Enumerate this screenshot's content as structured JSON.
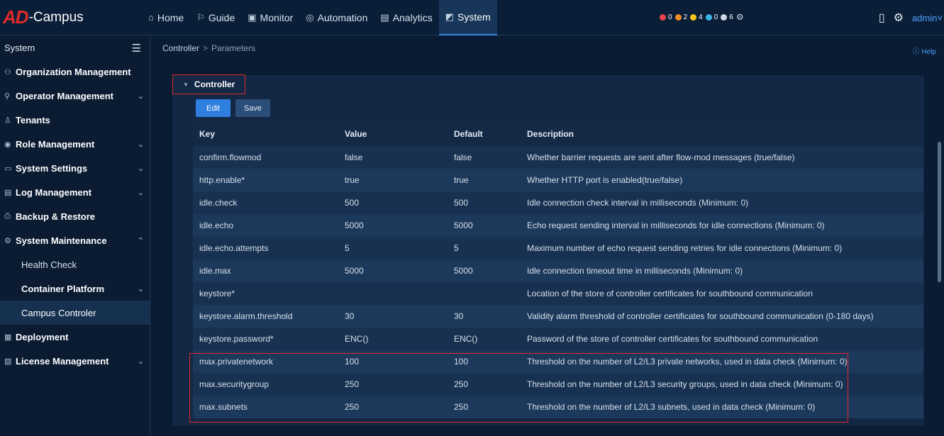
{
  "logo": {
    "mark": "AD",
    "text": "-Campus"
  },
  "nav": [
    {
      "icon": "⌂",
      "label": "Home"
    },
    {
      "icon": "⚐",
      "label": "Guide"
    },
    {
      "icon": "▣",
      "label": "Monitor"
    },
    {
      "icon": "◎",
      "label": "Automation"
    },
    {
      "icon": "▤",
      "label": "Analytics"
    },
    {
      "icon": "◩",
      "label": "System"
    }
  ],
  "alarms": [
    {
      "count": "0",
      "color": "#e8434b"
    },
    {
      "count": "2",
      "color": "#f08c2a"
    },
    {
      "count": "4",
      "color": "#f5c518"
    },
    {
      "count": "0",
      "color": "#3bb4e8"
    },
    {
      "count": "6",
      "color": "#cfd8e4"
    }
  ],
  "user": {
    "name": "admin"
  },
  "sidebar": {
    "title": "System",
    "items": [
      {
        "label": "Organization Management",
        "icon": "⚇"
      },
      {
        "label": "Operator Management",
        "icon": "⚲"
      },
      {
        "label": "Tenants",
        "icon": "♙"
      },
      {
        "label": "Role Management",
        "icon": "◉"
      },
      {
        "label": "System Settings",
        "icon": "▭"
      },
      {
        "label": "Log Management",
        "icon": "▤"
      },
      {
        "label": "Backup & Restore",
        "icon": "⎙"
      },
      {
        "label": "System Maintenance",
        "icon": "⚙"
      }
    ],
    "subitems": [
      {
        "label": "Health Check"
      },
      {
        "label": "Container Platform"
      },
      {
        "label": "Campus Controler"
      }
    ],
    "items2": [
      {
        "label": "Deployment",
        "icon": "▦"
      },
      {
        "label": "License Management",
        "icon": "▧"
      }
    ]
  },
  "breadcrumb": {
    "parent": "Controller",
    "separator": ">",
    "current": "Parameters"
  },
  "help": "Help",
  "section": {
    "title": "Controller"
  },
  "buttons": {
    "edit": "Edit",
    "save": "Save"
  },
  "table": {
    "headers": [
      "Key",
      "Value",
      "Default",
      "Description"
    ],
    "rows": [
      [
        "confirm.flowmod",
        "false",
        "false",
        "Whether barrier requests are sent after flow-mod messages (true/false)"
      ],
      [
        "http.enable*",
        "true",
        "true",
        "Whether HTTP port is enabled(true/false)"
      ],
      [
        "idle.check",
        "500",
        "500",
        "Idle connection check interval in milliseconds (Minimum: 0)"
      ],
      [
        "idle.echo",
        "5000",
        "5000",
        "Echo request sending interval in milliseconds for idle connections (Minimum: 0)"
      ],
      [
        "idle.echo.attempts",
        "5",
        "5",
        "Maximum number of echo request sending retries for idle connections (Minimum: 0)"
      ],
      [
        "idle.max",
        "5000",
        "5000",
        "Idle connection timeout time in milliseconds (Minimum: 0)"
      ],
      [
        "keystore*",
        "",
        "",
        "Location of the store of controller certificates for southbound communication"
      ],
      [
        "keystore.alarm.threshold",
        "30",
        "30",
        "Validity alarm threshold of controller certificates for southbound communication (0-180 days)"
      ],
      [
        "keystore.password*",
        "ENC()",
        "ENC()",
        "Password of the store of controller certificates for southbound communication"
      ],
      [
        "max.privatenetwork",
        "100",
        "100",
        "Threshold on the number of L2/L3 private networks, used in data check (Minimum: 0)"
      ],
      [
        "max.securitygroup",
        "250",
        "250",
        "Threshold on the number of L2/L3 security groups, used in data check (Minimum: 0)"
      ],
      [
        "max.subnets",
        "250",
        "250",
        "Threshold on the number of L2/L3 subnets, used in data check (Minimum: 0)"
      ]
    ]
  }
}
